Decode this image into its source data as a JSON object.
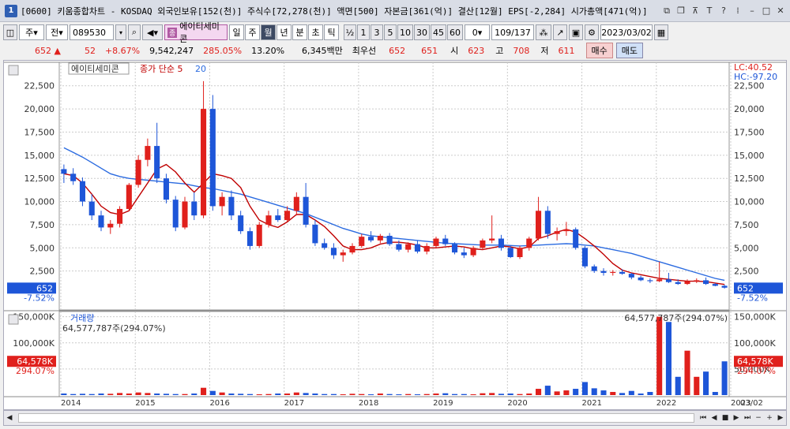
{
  "window": {
    "badge": "1",
    "title": "[0600] 키움종합차트 - KOSDAQ 외국인보유[152(천)] 주식수[72,278(천)] 액면[500] 자본금[361(억)] 결산[12월] EPS[-2,284] 시가총액[471(억)]"
  },
  "toolbar": {
    "period_mode": "주",
    "prev_label": "전",
    "code": "089530",
    "stock_name": "에이티세미콘",
    "stock_icon": "종",
    "periods": [
      "일",
      "주",
      "월",
      "년",
      "분",
      "초",
      "틱"
    ],
    "active_period": "월",
    "intervals": [
      "½",
      "1",
      "3",
      "5",
      "10",
      "30",
      "45",
      "60"
    ],
    "count_value": "0",
    "page": "109/137",
    "date": "2023/03/02"
  },
  "quote": {
    "price": "652",
    "arrow": "▲",
    "change": "52",
    "change_pct": "+8.67%",
    "volume": "9,542,247",
    "vol_ratio": "285.05%",
    "turnover": "13.20%",
    "amount": "6,345백만",
    "best_label": "최우선",
    "best_ask": "652",
    "best_bid": "651",
    "open_label": "시",
    "open": "623",
    "high_label": "고",
    "high": "708",
    "low_label": "저",
    "low": "611",
    "buy_label": "매수",
    "sell_label": "매도"
  },
  "chart": {
    "price_legend_name": "에이티세미콘",
    "price_legend_ma_label": "종가 단순 5",
    "price_legend_ma20": "20",
    "lc_label": "LC:40.52",
    "hc_label": "HC:-97.20",
    "price_ticks": [
      "22,500",
      "20,000",
      "17,500",
      "15,000",
      "12,500",
      "10,000",
      "7,500",
      "5,000",
      "2,500"
    ],
    "cur_price_tag": "652",
    "cur_price_pct": "-7.52%",
    "volume_legend": "거래량",
    "volume_current": "64,577,787주(294.07%)",
    "volume_ticks": [
      "150,000K",
      "100,000K",
      "50,000K"
    ],
    "vol_tag": "64,578K",
    "vol_pct": "294.07%",
    "year_labels": [
      "2014",
      "2015",
      "2016",
      "2017",
      "2018",
      "2019",
      "2020",
      "2021",
      "2022",
      "2023"
    ],
    "right_date": "03/02"
  },
  "colors": {
    "up": "#e0201c",
    "down": "#1e56d8",
    "ma5": "#c00000",
    "ma20": "#2b6be0"
  },
  "chart_data": {
    "type": "candlestick",
    "ylim": [
      0,
      23500
    ],
    "volume_ylim": [
      0,
      160000
    ],
    "volume_unit": "K",
    "candles": [
      [
        0,
        13500,
        14000,
        12000,
        13000
      ],
      [
        1,
        13000,
        13600,
        11800,
        12200
      ],
      [
        2,
        12200,
        12600,
        9500,
        10000
      ],
      [
        3,
        10000,
        10800,
        8000,
        8500
      ],
      [
        4,
        8500,
        9000,
        6800,
        7200
      ],
      [
        5,
        7200,
        8000,
        6500,
        7600
      ],
      [
        6,
        7600,
        9500,
        7200,
        9200
      ],
      [
        7,
        9200,
        12000,
        9000,
        11800
      ],
      [
        8,
        11800,
        15000,
        11500,
        14500
      ],
      [
        9,
        14500,
        16800,
        13800,
        16000
      ],
      [
        10,
        16000,
        18500,
        12000,
        12500
      ],
      [
        11,
        12500,
        13000,
        9800,
        10200
      ],
      [
        12,
        10200,
        10600,
        6800,
        7200
      ],
      [
        13,
        7200,
        10500,
        7000,
        10000
      ],
      [
        14,
        10000,
        11000,
        8000,
        8500
      ],
      [
        15,
        8500,
        23000,
        8200,
        20000
      ],
      [
        16,
        20000,
        21500,
        9000,
        9500
      ],
      [
        17,
        9500,
        11000,
        8500,
        10500
      ],
      [
        18,
        10500,
        11200,
        8000,
        8500
      ],
      [
        19,
        8500,
        9000,
        6500,
        6800
      ],
      [
        20,
        6800,
        7200,
        4800,
        5200
      ],
      [
        21,
        5200,
        7800,
        5000,
        7500
      ],
      [
        22,
        7500,
        9000,
        7200,
        8500
      ],
      [
        23,
        8500,
        9200,
        7800,
        8000
      ],
      [
        24,
        8000,
        9500,
        7800,
        9000
      ],
      [
        25,
        9000,
        11000,
        8500,
        10500
      ],
      [
        26,
        10500,
        12000,
        7200,
        7500
      ],
      [
        27,
        7500,
        8000,
        5200,
        5500
      ],
      [
        28,
        5500,
        6000,
        4800,
        5000
      ],
      [
        29,
        5000,
        5500,
        3800,
        4200
      ],
      [
        30,
        4200,
        4800,
        3500,
        4500
      ],
      [
        31,
        4500,
        5500,
        4300,
        5200
      ],
      [
        32,
        5200,
        6500,
        5000,
        6200
      ],
      [
        33,
        6200,
        6800,
        5600,
        5800
      ],
      [
        34,
        5800,
        6500,
        5500,
        6300
      ],
      [
        35,
        6300,
        6600,
        5200,
        5400
      ],
      [
        36,
        5400,
        5800,
        4600,
        4800
      ],
      [
        37,
        4800,
        5600,
        4500,
        5400
      ],
      [
        38,
        5400,
        5800,
        4400,
        4600
      ],
      [
        39,
        4600,
        5500,
        4300,
        5200
      ],
      [
        40,
        5200,
        6200,
        5000,
        6000
      ],
      [
        41,
        6000,
        6400,
        5200,
        5400
      ],
      [
        42,
        5400,
        5600,
        4300,
        4500
      ],
      [
        43,
        4500,
        5000,
        3900,
        4200
      ],
      [
        44,
        4200,
        5200,
        4000,
        5000
      ],
      [
        45,
        5000,
        6000,
        4800,
        5800
      ],
      [
        46,
        5800,
        8500,
        5500,
        6000
      ],
      [
        47,
        6000,
        6400,
        4700,
        5000
      ],
      [
        48,
        5000,
        5200,
        3900,
        4000
      ],
      [
        49,
        4000,
        5200,
        3800,
        5000
      ],
      [
        50,
        5000,
        6200,
        4700,
        6000
      ],
      [
        51,
        6000,
        10500,
        5800,
        9000
      ],
      [
        52,
        9000,
        9500,
        6000,
        6500
      ],
      [
        53,
        6500,
        7200,
        5800,
        6800
      ],
      [
        54,
        6800,
        7800,
        6300,
        7000
      ],
      [
        55,
        7000,
        7200,
        4800,
        5000
      ],
      [
        56,
        5000,
        5200,
        2800,
        3000
      ],
      [
        57,
        3000,
        3200,
        2300,
        2500
      ],
      [
        58,
        2500,
        2800,
        2000,
        2300
      ],
      [
        59,
        2300,
        2600,
        2000,
        2400
      ],
      [
        60,
        2400,
        2700,
        2100,
        2200
      ],
      [
        61,
        2200,
        2300,
        1600,
        1800
      ],
      [
        62,
        1800,
        2000,
        1400,
        1500
      ],
      [
        63,
        1500,
        1700,
        1200,
        1400
      ],
      [
        64,
        1400,
        3500,
        1300,
        1600
      ],
      [
        65,
        1600,
        2300,
        1200,
        1300
      ],
      [
        66,
        1300,
        1600,
        1000,
        1100
      ],
      [
        67,
        1100,
        1600,
        1000,
        1400
      ],
      [
        68,
        1400,
        1700,
        1200,
        1500
      ],
      [
        69,
        1500,
        1800,
        1000,
        1100
      ],
      [
        70,
        1100,
        1200,
        850,
        900
      ],
      [
        71,
        900,
        1000,
        600,
        700
      ]
    ],
    "ma5": [
      13000,
      12800,
      12000,
      10800,
      9500,
      8800,
      8600,
      9000,
      10500,
      12000,
      13500,
      14000,
      13200,
      12000,
      11000,
      12000,
      13000,
      12800,
      12500,
      11500,
      9500,
      8000,
      7500,
      7200,
      7800,
      8600,
      8600,
      8000,
      7300,
      6300,
      5200,
      4800,
      4800,
      5000,
      5400,
      5600,
      5600,
      5500,
      5300,
      5000,
      5000,
      5100,
      5200,
      5100,
      4900,
      4800,
      5000,
      5200,
      5100,
      4900,
      5100,
      6000,
      6300,
      6700,
      7000,
      6700,
      6000,
      5200,
      4300,
      3300,
      2600,
      2300,
      2100,
      1900,
      1700,
      1600,
      1500,
      1400,
      1400,
      1350,
      1200,
      1050
    ],
    "ma20": [
      15800,
      15300,
      14800,
      14200,
      13600,
      13000,
      12700,
      12500,
      12400,
      12300,
      12200,
      12100,
      12000,
      11900,
      11700,
      11500,
      11400,
      11200,
      11000,
      10800,
      10500,
      10200,
      9900,
      9600,
      9300,
      9000,
      8700,
      8300,
      7900,
      7500,
      7100,
      6800,
      6500,
      6300,
      6200,
      6100,
      6000,
      5900,
      5800,
      5700,
      5600,
      5500,
      5450,
      5400,
      5350,
      5300,
      5300,
      5300,
      5250,
      5200,
      5250,
      5300,
      5350,
      5400,
      5450,
      5400,
      5300,
      5200,
      5000,
      4800,
      4600,
      4400,
      4100,
      3800,
      3500,
      3200,
      2900,
      2600,
      2300,
      2000,
      1700,
      1500
    ],
    "volume": [
      [
        0,
        3000
      ],
      [
        1,
        2000
      ],
      [
        2,
        2500
      ],
      [
        3,
        2000
      ],
      [
        4,
        3000
      ],
      [
        5,
        2500
      ],
      [
        6,
        4000
      ],
      [
        7,
        3000
      ],
      [
        8,
        5000
      ],
      [
        9,
        4000
      ],
      [
        10,
        3000
      ],
      [
        11,
        2500
      ],
      [
        12,
        2000
      ],
      [
        13,
        2000
      ],
      [
        14,
        3000
      ],
      [
        15,
        14000
      ],
      [
        16,
        8000
      ],
      [
        17,
        5000
      ],
      [
        18,
        3000
      ],
      [
        19,
        2500
      ],
      [
        20,
        2000
      ],
      [
        21,
        1500
      ],
      [
        22,
        2000
      ],
      [
        23,
        3000
      ],
      [
        24,
        3000
      ],
      [
        25,
        5000
      ],
      [
        26,
        4000
      ],
      [
        27,
        3000
      ],
      [
        28,
        2000
      ],
      [
        29,
        2000
      ],
      [
        30,
        1500
      ],
      [
        31,
        2500
      ],
      [
        32,
        2000
      ],
      [
        33,
        1500
      ],
      [
        34,
        3000
      ],
      [
        35,
        2000
      ],
      [
        36,
        1500
      ],
      [
        37,
        2000
      ],
      [
        38,
        1500
      ],
      [
        39,
        2000
      ],
      [
        40,
        3000
      ],
      [
        41,
        3500
      ],
      [
        42,
        2000
      ],
      [
        43,
        2000
      ],
      [
        44,
        1500
      ],
      [
        45,
        3500
      ],
      [
        46,
        4000
      ],
      [
        47,
        2500
      ],
      [
        48,
        3000
      ],
      [
        49,
        2000
      ],
      [
        50,
        3000
      ],
      [
        51,
        12000
      ],
      [
        52,
        18000
      ],
      [
        53,
        7000
      ],
      [
        54,
        9000
      ],
      [
        55,
        12000
      ],
      [
        56,
        25000
      ],
      [
        57,
        13000
      ],
      [
        58,
        9000
      ],
      [
        59,
        6000
      ],
      [
        60,
        4000
      ],
      [
        61,
        8000
      ],
      [
        62,
        3000
      ],
      [
        63,
        6000
      ],
      [
        64,
        150000
      ],
      [
        65,
        140000
      ],
      [
        66,
        35000
      ],
      [
        67,
        85000
      ],
      [
        68,
        35000
      ],
      [
        69,
        45000
      ],
      [
        70,
        6000
      ],
      [
        71,
        64578
      ]
    ]
  }
}
